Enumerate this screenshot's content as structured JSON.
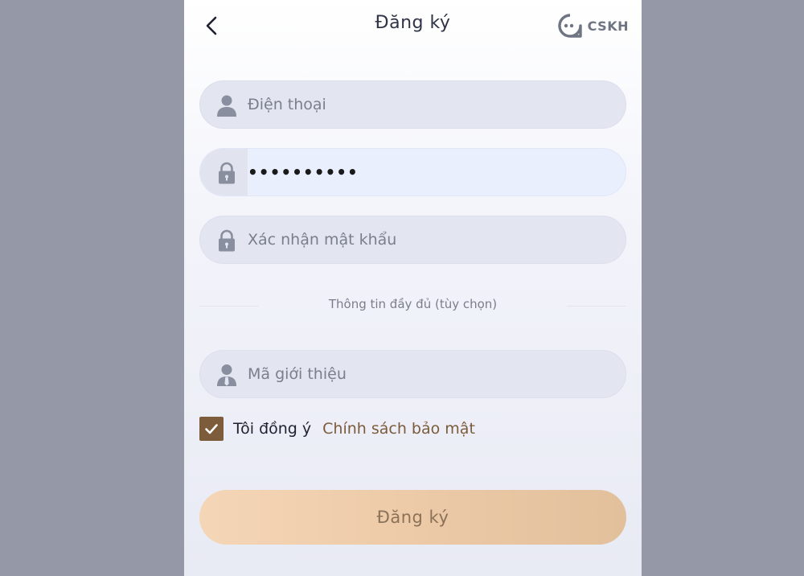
{
  "header": {
    "title": "Đăng ký",
    "support_label": "CSKH"
  },
  "form": {
    "phone": {
      "placeholder": "Điện thoại",
      "value": "",
      "icon": "user-icon"
    },
    "password": {
      "placeholder": "",
      "value": "••••••••••",
      "icon": "lock-icon"
    },
    "confirm_password": {
      "placeholder": "Xác nhận mật khẩu",
      "value": "",
      "icon": "lock-icon"
    },
    "optional_divider": "Thông tin đầy đủ (tùy chọn)",
    "referral": {
      "placeholder": "Mã giới thiệu",
      "value": "",
      "icon": "referrer-icon"
    },
    "agree": {
      "checked": true,
      "label": "Tôi đồng ý",
      "policy_link": "Chính sách bảo mật"
    },
    "submit_label": "Đăng ký"
  },
  "colors": {
    "accent_brown": "#7d5c3b",
    "button_gradient_start": "#f4d6b7",
    "button_gradient_end": "#e2c09c",
    "backdrop": "#9598a7"
  }
}
